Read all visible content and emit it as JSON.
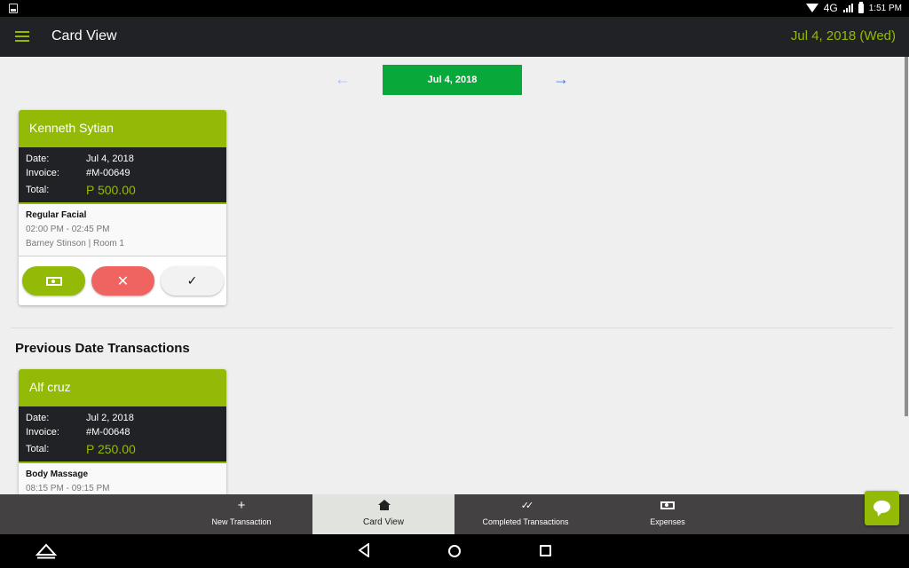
{
  "status_bar": {
    "network": "4G",
    "time": "1:51 PM"
  },
  "app_bar": {
    "title": "Card View",
    "date": "Jul 4, 2018 (Wed)"
  },
  "date_nav": {
    "current": "Jul 4, 2018"
  },
  "labels": {
    "date": "Date:",
    "invoice": "Invoice:",
    "total": "Total:"
  },
  "today_cards": [
    {
      "customer": "Kenneth Sytian",
      "date": "Jul 4, 2018",
      "invoice": "#M-00649",
      "total": "P 500.00",
      "service": "Regular Facial",
      "time": "02:00 PM - 02:45 PM",
      "staff_room": "Barney Stinson | Room 1"
    }
  ],
  "actions": {
    "pay": "▭",
    "cancel": "✕",
    "done": "✓"
  },
  "previous_section": {
    "title": "Previous Date Transactions"
  },
  "previous_cards": [
    {
      "customer": "Alf cruz",
      "date": "Jul 2, 2018",
      "invoice": "#M-00648",
      "total": "P 250.00",
      "service": "Body Massage",
      "time": "08:15 PM - 09:15 PM"
    }
  ],
  "bottom_nav": [
    {
      "label": "New Transaction",
      "icon": "plus-icon",
      "glyph": "+"
    },
    {
      "label": "Card View",
      "icon": "home-icon",
      "active": true
    },
    {
      "label": "Completed Transactions",
      "icon": "double-check-icon",
      "glyph": "✓✓"
    },
    {
      "label": "Expenses",
      "icon": "cash-icon"
    }
  ],
  "colors": {
    "brand_green": "#93ba06",
    "date_pill_green": "#09a83b",
    "cancel_red": "#ef6461",
    "dark": "#212225"
  }
}
